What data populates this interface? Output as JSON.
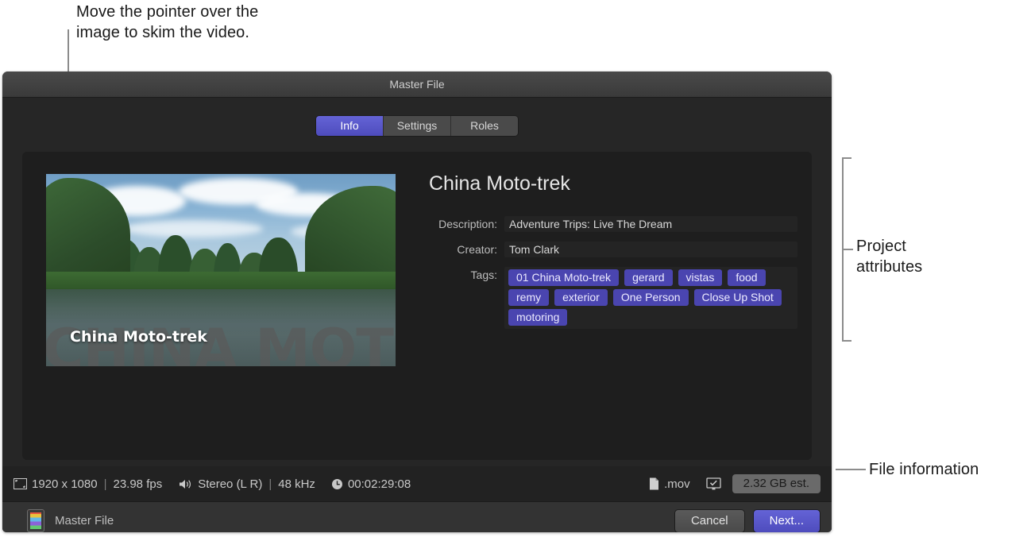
{
  "annotations": {
    "skim_callout": "Move the pointer over the\nimage to skim the video.",
    "project_attributes_label": "Project\nattributes",
    "file_information_label": "File information"
  },
  "window": {
    "title": "Master File"
  },
  "tabs": [
    {
      "label": "Info",
      "selected": true
    },
    {
      "label": "Settings",
      "selected": false
    },
    {
      "label": "Roles",
      "selected": false
    }
  ],
  "preview": {
    "overlay_big_text": "CHINA MOTO-TREK",
    "overlay_label": "China Moto-trek"
  },
  "project": {
    "title": "China Moto-trek",
    "fields": [
      {
        "label": "Description:",
        "value": "Adventure Trips: Live The Dream"
      },
      {
        "label": "Creator:",
        "value": "Tom Clark"
      }
    ],
    "tags_label": "Tags:",
    "tags": [
      "01 China Moto-trek",
      "gerard",
      "vistas",
      "food",
      "remy",
      "exterior",
      "One Person",
      "Close Up Shot",
      "motoring"
    ]
  },
  "file_info": {
    "resolution": "1920 x 1080",
    "frame_rate": "23.98 fps",
    "audio_channels": "Stereo (L R)",
    "sample_rate": "48 kHz",
    "duration": "00:02:29:08",
    "separator": "|",
    "file_extension": ".mov",
    "size_estimate": "2.32 GB est."
  },
  "toolbar": {
    "title": "Master File",
    "cancel_label": "Cancel",
    "next_label": "Next..."
  },
  "colors": {
    "accent": "#5a57c8",
    "tag": "#4a45b0",
    "window_bg": "#262626",
    "panel_bg": "#1e1e1e"
  }
}
